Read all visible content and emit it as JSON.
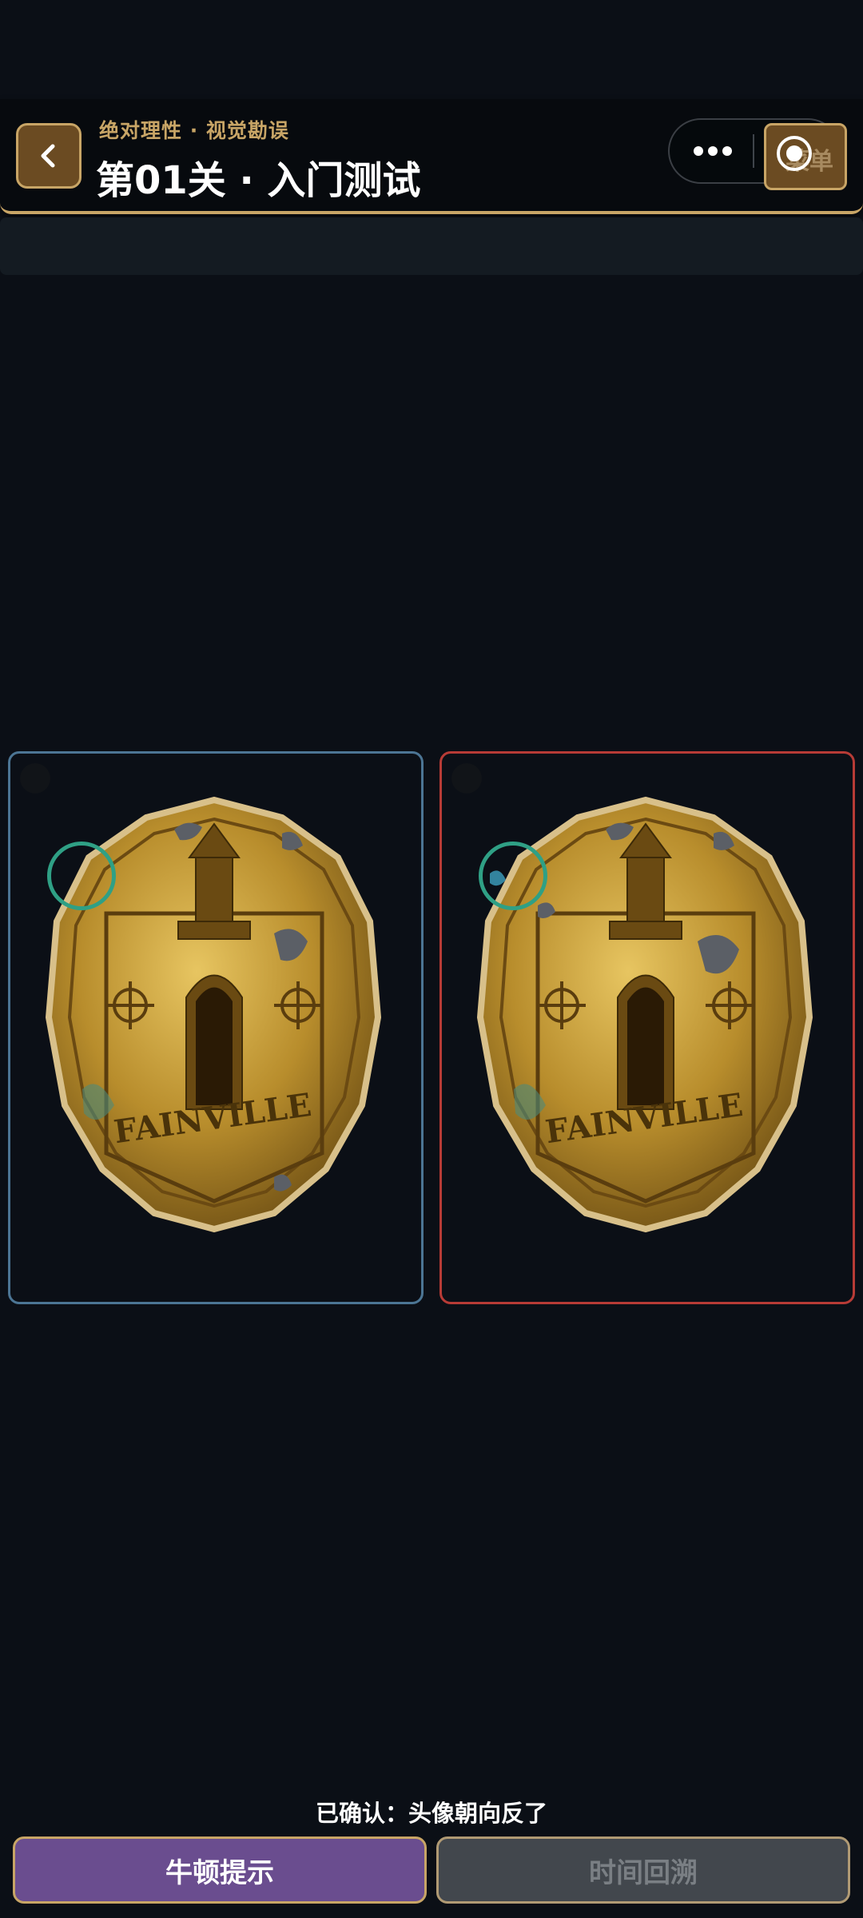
{
  "header": {
    "subtitle": "绝对理性 · 视觉勘误",
    "title": "第01关 · 入门测试",
    "menu_label": "菜单",
    "back_icon": "chevron-left-icon",
    "more_icon": "more-dots-icon",
    "close_icon": "target-circle-icon"
  },
  "puzzle": {
    "left_image": "coin-fainville-original",
    "right_image": "coin-fainville-altered",
    "coin_text": "FAINVILLE",
    "found_marker_color": "#2fa085",
    "left_border_color": "#4c7594",
    "right_border_color": "#b73b36"
  },
  "status": {
    "confirmed_text": "已确认：头像朝向反了"
  },
  "buttons": {
    "hint_label": "牛顿提示",
    "rewind_label": "时间回溯"
  },
  "colors": {
    "background": "#0b0f16",
    "accent_gold": "#c8a566",
    "hint_purple": "#6a4d8f",
    "disabled_gray": "#42474d"
  }
}
